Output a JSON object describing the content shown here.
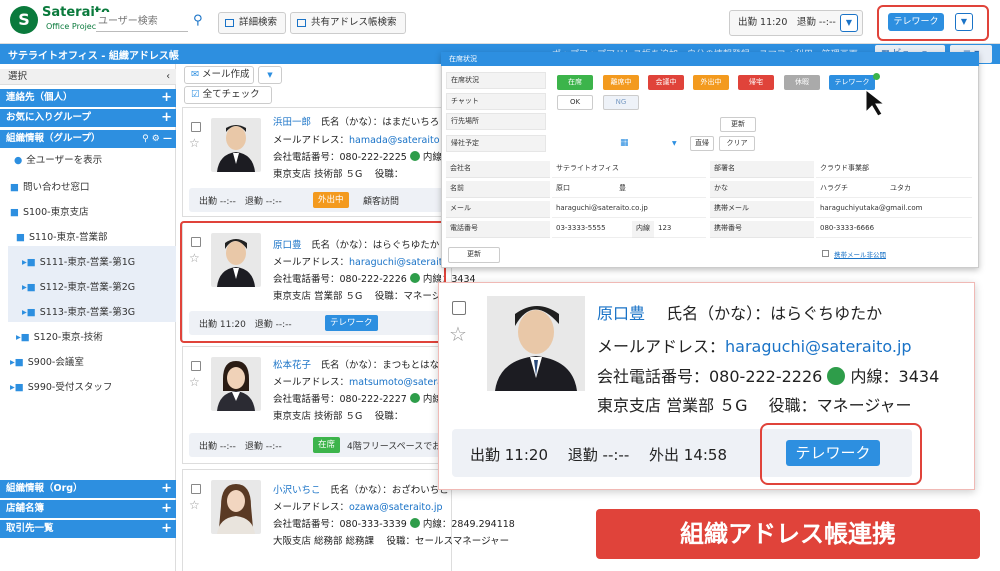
{
  "header": {
    "logo_letter": "S",
    "brand": "Sateraito",
    "brand_sub": "Office Project",
    "search_placeholder": "ユーザー検索",
    "detail_search": "詳細検索",
    "shared_search": "共有アドレス帳検索",
    "attendance": "出勤 11:20　退勤 --:--",
    "status_badge": "テレワーク"
  },
  "appbar": {
    "title": "サテライトオフィス - 組織アドレス帳",
    "note": "ポップアップアドレス帳を追加　自分の情報登録　スマフォ利用　管理画面",
    "view_label": "ビュー",
    "menu_label": "≡"
  },
  "sidebar": {
    "select_label": "選択",
    "sections_top": [
      "連絡先（個人）",
      "お気に入りグループ",
      "組織情報（グループ）"
    ],
    "all_users": "全ユーザーを表示",
    "tree": [
      {
        "label": "問い合わせ窓口",
        "level": 0
      },
      {
        "label": "S100-東京支店",
        "level": 0
      },
      {
        "label": "S110-東京-営業部",
        "level": 1
      },
      {
        "label": "S111-東京-営業-第1G",
        "level": 2
      },
      {
        "label": "S112-東京-営業-第2G",
        "level": 2
      },
      {
        "label": "S113-東京-営業-第3G",
        "level": 2
      },
      {
        "label": "S120-東京-技術",
        "level": 1
      },
      {
        "label": "S900-会議室",
        "level": 0
      },
      {
        "label": "S990-受付スタッフ",
        "level": 0
      }
    ],
    "sections_bottom": [
      "組織情報（Org）",
      "店舗名簿",
      "取引先一覧"
    ]
  },
  "toolbar": {
    "compose": "メール作成",
    "check_all": "全てチェック"
  },
  "cards": [
    {
      "name": "浜田一郎",
      "kana": "氏名（かな）：はまだいちろ",
      "email_label": "メールアドレス：",
      "email": "hamada@sateraito",
      "phone": "会社電話番号：080-222-2225",
      "ext": "内線",
      "dept": "東京支店 技術部 ５G　 役職：",
      "attend": "出勤 --:--　退勤 --:--",
      "status": "外出中",
      "status_color": "#f39a1e",
      "note": "顧客訪問"
    },
    {
      "name": "原口豊",
      "kana": "氏名（かな）：はらぐちゆたか",
      "email_label": "メールアドレス：",
      "email": "haraguchi@sateraito",
      "phone": "会社電話番号：080-222-2226",
      "ext": "内線：3434",
      "dept": "東京支店 営業部 ５G　 役職：マネージャ",
      "attend": "出勤 11:20　退勤 --:--",
      "status": "テレワーク",
      "status_color": "#2d8fe0",
      "note": ""
    },
    {
      "name": "松本花子",
      "kana": "氏名（かな）：まつもとはな",
      "email_label": "メールアドレス：",
      "email": "matsumoto@sateraito",
      "phone": "会社電話番号：080-222-2227",
      "ext": "内線",
      "dept": "東京支店 技術部 ５G　 役職：",
      "attend": "出勤 --:--　退勤 --:--",
      "status": "在席",
      "status_color": "#3cb44b",
      "note": "4階フリースペースでお"
    },
    {
      "name": "小沢いちこ",
      "kana": "氏名（かな）：おざわいちこ",
      "email_label": "メールアドレス：",
      "email": "ozawa@sateraito.jp",
      "phone": "会社電話番号：080-333-3339",
      "ext": "内線：2849.294118",
      "dept": "大阪支店 総務部 総務課　 役職：セールスマネージャー",
      "attend": "",
      "status": "",
      "status_color": "",
      "note": ""
    }
  ],
  "modal": {
    "title": "在席状況",
    "row_labels": [
      "在席状況",
      "チャット",
      "行先場所",
      "帰社予定"
    ],
    "statuses": [
      {
        "label": "在席",
        "color": "#3cb44b"
      },
      {
        "label": "離席中",
        "color": "#f39a1e"
      },
      {
        "label": "会議中",
        "color": "#e0433a"
      },
      {
        "label": "外出中",
        "color": "#f39a1e"
      },
      {
        "label": "帰宅",
        "color": "#e0433a"
      },
      {
        "label": "休暇",
        "color": "#aaaaaa"
      },
      {
        "label": "テレワーク",
        "color": "#2d8fe0"
      }
    ],
    "chat_ok": "OK",
    "chat_ng": "NG",
    "update": "更新",
    "direct": "直帰",
    "clear": "クリア",
    "fields_left": [
      {
        "label": "会社名",
        "value": "サテライトオフィス"
      },
      {
        "label": "名前",
        "value": "原口　　　　　　　豊"
      },
      {
        "label": "メール",
        "value": "haraguchi@sateraito.co.jp"
      },
      {
        "label": "電話番号",
        "value": "03-3333-5555"
      }
    ],
    "ext_label": "内線",
    "ext_value": "123",
    "fields_right": [
      {
        "label": "部署名",
        "value": "クラウド事業部"
      },
      {
        "label": "かな",
        "value": "ハラグチ　　　　　　ユタカ"
      },
      {
        "label": "携帯メール",
        "value": "haraguchiyutaka@gmail.com"
      },
      {
        "label": "携帯番号",
        "value": "080-3333-6666"
      }
    ],
    "submit": "更新",
    "mobile_private": "携帯メール非公開"
  },
  "zoom": {
    "name": "原口豊",
    "kana": "氏名（かな）：はらぐちゆたか",
    "email_label": "メールアドレス：",
    "email": "haraguchi@sateraito.jp",
    "phone": "会社電話番号：080-222-2226",
    "ext": "内線：3434",
    "dept": "東京支店 営業部 ５G　 役職：マネージャー",
    "attend": "出勤 11:20　 退勤 --:--　 外出 14:58",
    "status": "テレワーク"
  },
  "banner": "組織アドレス帳連携",
  "colors": {
    "brand": "#0a7a3c",
    "primary": "#2d8fe0",
    "accent": "#e0433a"
  }
}
